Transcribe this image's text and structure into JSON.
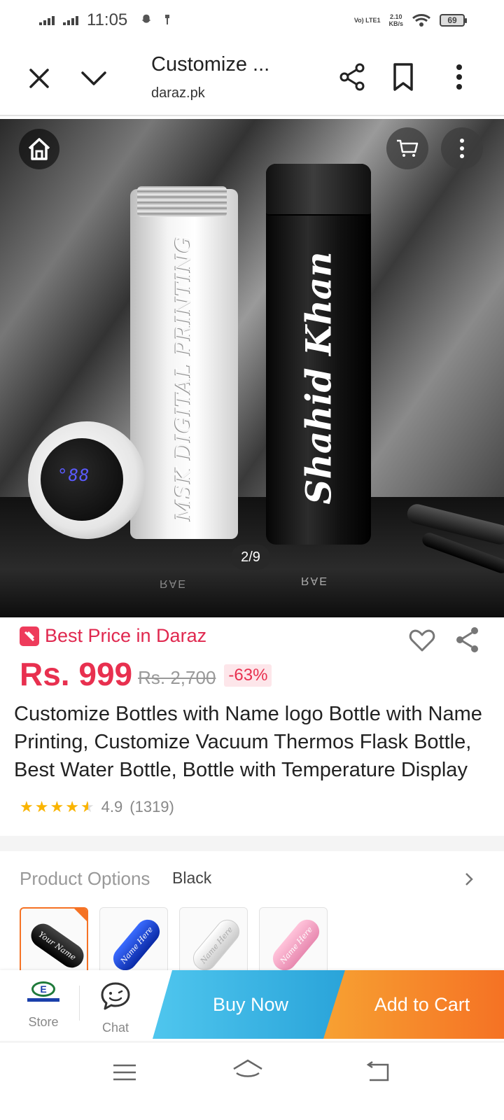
{
  "status_bar": {
    "time": "11:05",
    "network_label": "Vo) LTE1",
    "speed_value": "2.10",
    "speed_unit": "KB/s",
    "battery": "69"
  },
  "browser": {
    "title": "Customize ...",
    "url": "daraz.pk",
    "icons": [
      "close-icon",
      "chevron-down-icon",
      "share-icon",
      "bookmark-icon",
      "more-vertical-icon"
    ]
  },
  "gallery": {
    "counter": "2/9",
    "engraving_white": "MSK DIGITAL PRINTING",
    "engraving_black": "Shahid Khan",
    "lid_display": "°88",
    "reflection_text": "RAE",
    "reflection_text_2": "RAE",
    "icons": [
      "home-icon",
      "cart-icon",
      "more-vertical-icon"
    ]
  },
  "product": {
    "badge": "Best Price in Daraz",
    "price": "Rs. 999",
    "old_price": "Rs. 2,700",
    "discount": "-63%",
    "title": "Customize Bottles with Name logo Bottle with Name Printing, Customize Vacuum Thermos Flask Bottle, Best Water Bottle, Bottle with Temperature Display",
    "rating": 4.5,
    "rating_text": "4.9",
    "rating_count": "(1319)"
  },
  "options": {
    "label": "Product Options",
    "selected": "Black",
    "variants": [
      {
        "color": "#111111",
        "text": "Your Name",
        "selected": true
      },
      {
        "color": "#1f46d6",
        "text": "Name Here",
        "selected": false
      },
      {
        "color": "#eeeeee",
        "text": "Name Here",
        "selected": false
      },
      {
        "color": "#f3a6c6",
        "text": "Name Here",
        "selected": false
      }
    ]
  },
  "action_bar": {
    "store_label": "Store",
    "chat_label": "Chat",
    "buy_now": "Buy Now",
    "add_to_cart": "Add to Cart"
  },
  "colors": {
    "accent_red": "#e8304f",
    "buy_blue": "#29a3d9",
    "cart_orange": "#f57224"
  }
}
